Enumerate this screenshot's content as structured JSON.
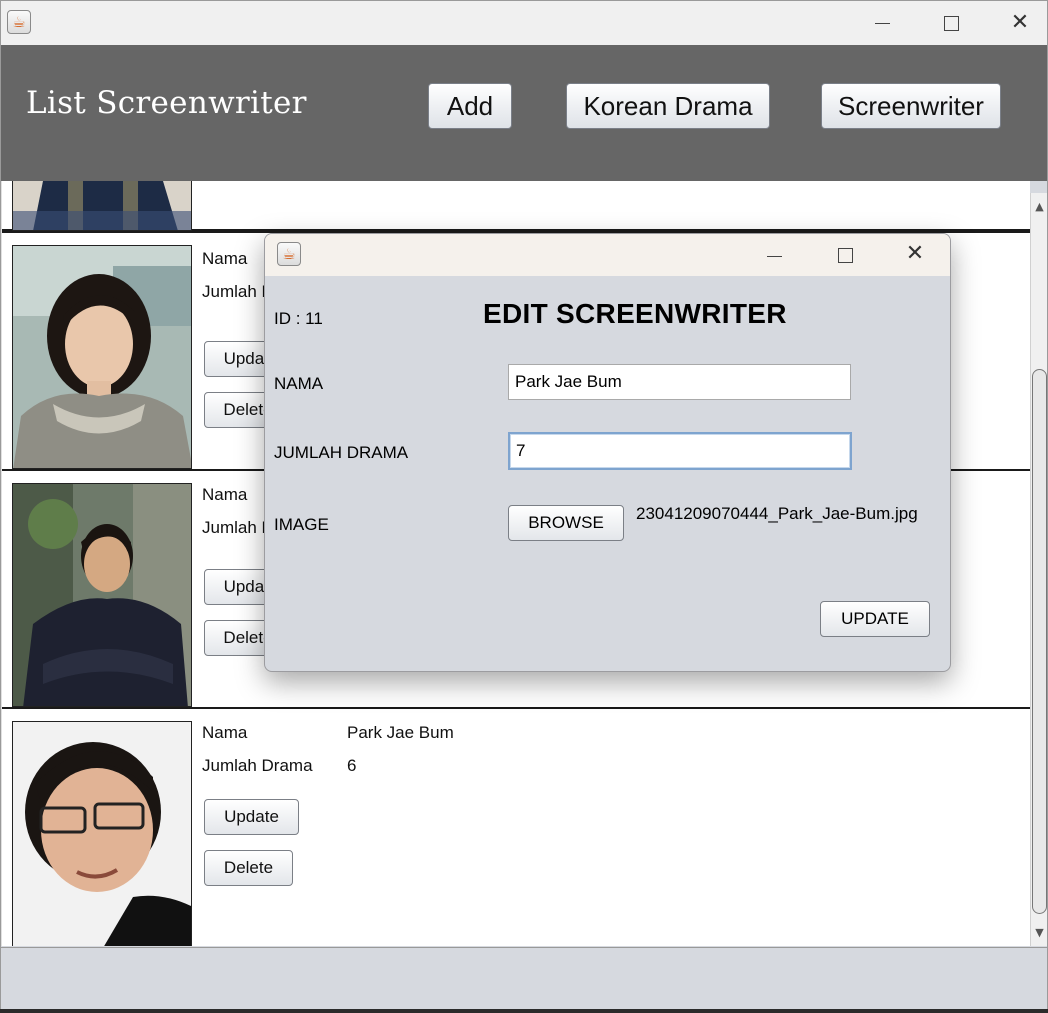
{
  "window": {
    "app_icon": "java-cup-icon",
    "controls": [
      "minimize",
      "maximize",
      "close"
    ]
  },
  "header": {
    "title": "List Screenwriter",
    "buttons": {
      "add": "Add",
      "korean_drama": "Korean Drama",
      "screenwriter": "Screenwriter"
    },
    "bg_color": "#666666"
  },
  "list": {
    "rows": [
      {
        "nama_label": "Nama",
        "jumlah_label": "Jumlah Drama",
        "update_label": "Update",
        "delete_label": "Delete"
      },
      {
        "nama_label": "Nama",
        "jumlah_label": "Jumlah Drama",
        "update_label": "Update",
        "delete_label": "Delete"
      },
      {
        "nama_label": "Nama",
        "jumlah_label": "Jumlah Drama",
        "nama_value": "Park Jae Bum",
        "jumlah_value": "6",
        "update_label": "Update",
        "delete_label": "Delete"
      }
    ]
  },
  "dialog": {
    "app_icon": "java-cup-icon",
    "id_text": "ID : 11",
    "heading": "EDIT SCREENWRITER",
    "nama_label": "NAMA",
    "nama_value": "Park Jae Bum",
    "jumlah_label": "JUMLAH DRAMA",
    "jumlah_value": "7",
    "image_label": "IMAGE",
    "browse_label": "BROWSE",
    "image_filename": "23041209070444_Park_Jae-Bum.jpg",
    "update_label": "UPDATE"
  },
  "colors": {
    "panel": "#d6d9df",
    "dialog_title": "#f5f1ec",
    "focus": "#7ea4cf"
  }
}
